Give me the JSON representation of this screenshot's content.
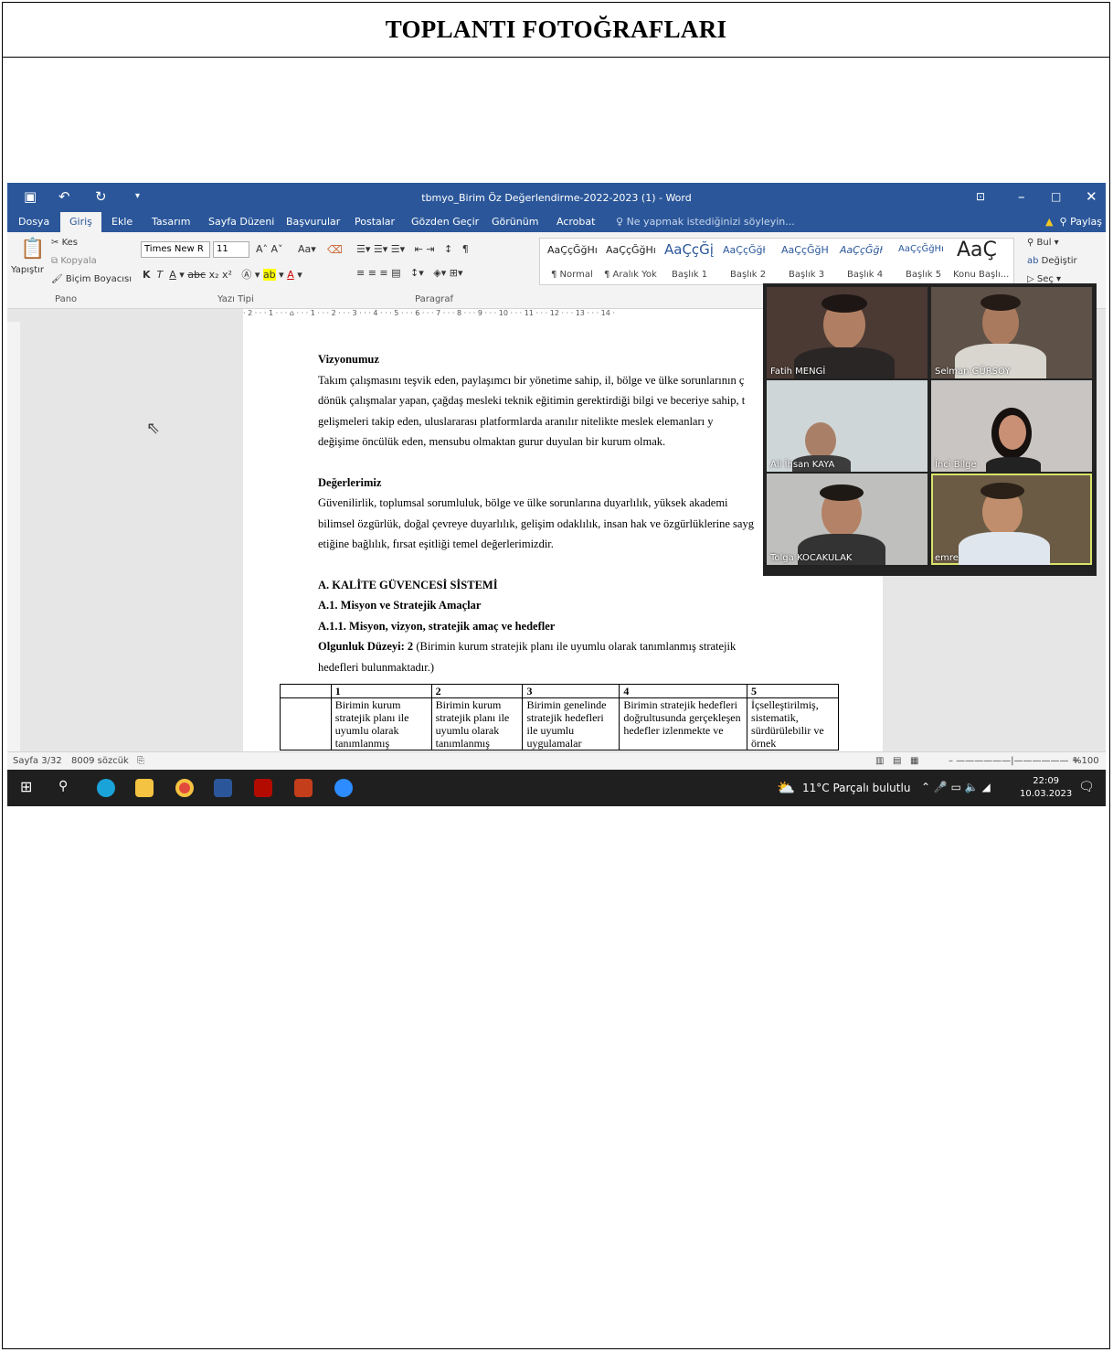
{
  "page": {
    "title": "TOPLANTI FOTOĞRAFLARI"
  },
  "window": {
    "title": "tbmyo_Birim Öz Değerlendirme-2022-2023 (1) - Word"
  },
  "menu": {
    "items": [
      "Dosya",
      "Giriş",
      "Ekle",
      "Tasarım",
      "Sayfa Düzeni",
      "Başvurular",
      "Postalar",
      "Gözden Geçir",
      "Görünüm",
      "Acrobat"
    ],
    "tell_me": "Ne yapmak istediğinizi söyleyin...",
    "share": "Paylaş"
  },
  "ribbon": {
    "clipboard": {
      "cut": "Kes",
      "copy": "Kopyala",
      "paste": "Yapıştır",
      "format_painter": "Biçim Boyacısı",
      "label": "Pano"
    },
    "font": {
      "name": "Times New R",
      "size": "11",
      "label": "Yazı Tipi"
    },
    "paragraph": {
      "label": "Paragraf"
    },
    "styles": [
      {
        "sample": "AaÇçĞğHı",
        "name": "¶ Normal"
      },
      {
        "sample": "AaÇçĞğHı",
        "name": "¶ Aralık Yok"
      },
      {
        "sample": "AaÇçĞį",
        "name": "Başlık 1"
      },
      {
        "sample": "AaÇçĞğł",
        "name": "Başlık 2"
      },
      {
        "sample": "AaÇçĞğH",
        "name": "Başlık 3"
      },
      {
        "sample": "AaÇçĞğł",
        "name": "Başlık 4"
      },
      {
        "sample": "AaÇçĞğHı",
        "name": "Başlık 5"
      },
      {
        "sample": "AaÇ",
        "name": "Konu Başlı..."
      }
    ],
    "editing": {
      "find": "Bul",
      "replace": "Değiştir",
      "select": "Seç"
    }
  },
  "document": {
    "vision_heading": "Vizyonumuz",
    "vision_lines": [
      "Takım çalışmasını teşvik eden, paylaşımcı bir yönetime sahip, il, bölge ve ülke sorunlarının ç",
      "dönük çalışmalar yapan, çağdaş mesleki teknik eğitimin gerektirdiği bilgi ve beceriye sahip, t",
      "gelişmeleri takip eden, uluslararası platformlarda aranılır nitelikte meslek elemanları y",
      "değişime öncülük eden, mensubu olmaktan gurur duyulan bir kurum olmak."
    ],
    "values_heading": "Değerlerimiz",
    "values_lines": [
      "Güvenilirlik, toplumsal sorumluluk, bölge ve ülke sorunlarına duyarlılık, yüksek akademi",
      "bilimsel özgürlük, doğal çevreye duyarlılık, gelişim odaklılık, insan hak ve özgürlüklerine sayg",
      "etiğine bağlılık, fırsat eşitliği temel değerlerimizdir."
    ],
    "section_a": "A.  KALİTE GÜVENCESİ SİSTEMİ",
    "section_a1": "A.1. Misyon ve Stratejik Amaçlar",
    "section_a11": "A.1.1. Misyon, vizyon, stratejik amaç ve hedefler",
    "maturity_label": "Olgunluk Düzeyi: 2",
    "maturity_text": " (Birimin kurum stratejik planı ile uyumlu olarak tanımlanmış stratejik",
    "maturity_text2": "hedefleri bulunmaktadır.)",
    "table": {
      "headers": [
        "",
        "1",
        "2",
        "3",
        "4",
        "5"
      ],
      "row": [
        "",
        "Birimin kurum stratejik planı ile uyumlu olarak tanımlanmış",
        "Birimin kurum stratejik planı ile uyumlu olarak tanımlanmış",
        "Birimin genelinde stratejik hedefleri ile uyumlu uygulamalar",
        "Birimin stratejik hedefleri doğrultusunda gerçekleşen hedefler izlenmekte ve",
        "İçselleştirilmiş, sistematik, sürdürülebilir ve örnek"
      ]
    }
  },
  "status": {
    "page": "Sayfa 3/32",
    "words": "8009 sözcük",
    "zoom": "%100"
  },
  "taskbar": {
    "weather": "11°C  Parçalı bulutlu",
    "time": "22:09",
    "date": "10.03.2023"
  },
  "participants": [
    {
      "name": "Fatih MENGİ"
    },
    {
      "name": "Selman GÜRSOY"
    },
    {
      "name": "Ali İhsan KAYA"
    },
    {
      "name": "İnci Bilge"
    },
    {
      "name": "Tolga KOCAKULAK"
    },
    {
      "name": "emre"
    }
  ],
  "colors": {
    "word_blue": "#2b579a",
    "active_speaker": "#d8e36a"
  }
}
